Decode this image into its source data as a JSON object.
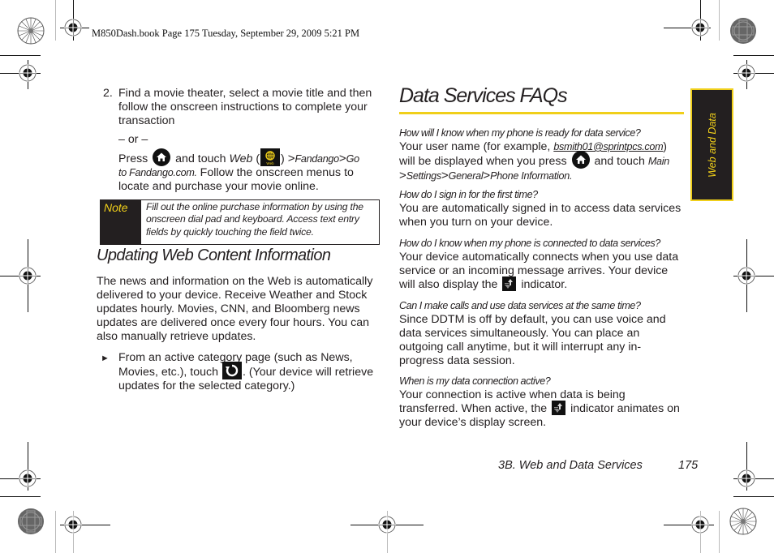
{
  "slug": "M850Dash.book  Page 175  Tuesday, September 29, 2009  5:21 PM",
  "left_column": {
    "step": {
      "number": "2.",
      "line1": "Find a movie theater, select a movie title and then",
      "line2": "follow the onscreen instructions to complete your",
      "line3": "transaction",
      "or": "– or –",
      "press": "Press",
      "and_touch": "and touch",
      "web": "Web",
      "open_paren": " (",
      "close_paren": ") ",
      "gt": ">",
      "fandango": "Fandango",
      "go": "Go",
      "to_fandango": "to Fandango.com.",
      "follow": " Follow the onscreen menus to",
      "locate": "locate and purchase your movie online.",
      "home_icon": "home-key-icon",
      "web_icon": "web-globe-icon",
      "web_icon_caption": "Web"
    },
    "note": {
      "label": "Note",
      "lines": [
        "Fill out the online purchase information by using the",
        "onscreen dial pad and keyboard. Access text entry",
        "fields by quickly touching the field twice."
      ]
    },
    "section_heading": "Updating Web Content Information",
    "paragraph_lines": [
      "The news and information on the Web is automatically",
      "delivered to your device. Receive Weather and Stock",
      "updates hourly. Movies, CNN, and Bloomberg news",
      "updates are delivered once every four hours. You can",
      "also manually retrieve updates."
    ],
    "bullet": {
      "marker": "►",
      "line1": "From an active category page (such as News,",
      "line2a": "Movies, etc.), touch",
      "line2b": ". (Your device will retrieve",
      "line3": "updates for the selected category.)",
      "refresh_icon": "refresh-icon"
    }
  },
  "right_column": {
    "title": "Data Services FAQs",
    "faqs": [
      {
        "question": "How will I know when my phone is ready for data service?",
        "a1_pre": "Your user name (for example, ",
        "a1_email": "bsmith01@sprintpcs.com",
        "a1_post": ")",
        "a2_pre": "will be displayed when you press",
        "a2_post": "and touch",
        "main": "Main",
        "gt": ">",
        "settings": "Settings",
        "general": "General",
        "phone_info": "Phone Information."
      },
      {
        "question": "How do I sign in for the first time?",
        "lines": [
          "You are automatically signed in to access data services",
          "when you turn on your device."
        ]
      },
      {
        "question": "How do I know when my phone is connected to data services?",
        "lines": [
          "Your device automatically connects when you use data",
          "service or an incoming message arrives. Your device"
        ],
        "last_pre": "will also display the",
        "last_post": "indicator."
      },
      {
        "question": "Can I make calls and use data services at the same time?",
        "lines": [
          "Since DDTM is off by default, you can use voice and",
          "data services simultaneously. You can place an",
          "outgoing call anytime, but it will interrupt any in-",
          "progress data session."
        ]
      },
      {
        "question": "When is my data connection active?",
        "line1": "Your connection is active when data is being",
        "line2_pre": "transferred. When active, the",
        "line2_post": "indicator animates on",
        "line3": "your device’s display screen."
      }
    ]
  },
  "side_tab": {
    "label": "Web and Data"
  },
  "footer": {
    "section": "3B. Web and Data Services",
    "page": "175"
  },
  "colors": {
    "accent_yellow": "#f0cf1a",
    "dark": "#231f20"
  }
}
